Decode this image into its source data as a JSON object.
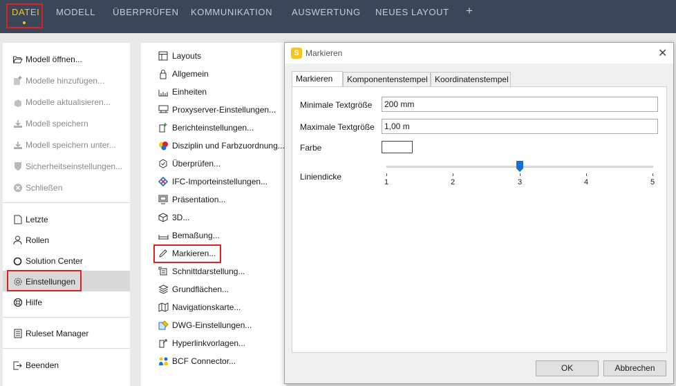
{
  "topbar": {
    "tabs": [
      "DATEI",
      "MODELL",
      "ÜBERPRÜFEN",
      "KOMMUNIKATION",
      "AUSWERTUNG",
      "NEUES LAYOUT"
    ],
    "add_tab": "+",
    "active_tab": "DATEI"
  },
  "left_menu": {
    "items": [
      {
        "label": "Modell öffnen...",
        "icon": "folder-open-icon",
        "enabled": true
      },
      {
        "label": "Modelle hinzufügen...",
        "icon": "add-model-icon",
        "enabled": false
      },
      {
        "label": "Modelle aktualisieren...",
        "icon": "refresh-model-icon",
        "enabled": false
      },
      {
        "label": "Modell speichern",
        "icon": "save-icon",
        "enabled": false
      },
      {
        "label": "Modell speichern unter...",
        "icon": "save-as-icon",
        "enabled": false
      },
      {
        "label": "Sicherheitseinstellungen...",
        "icon": "shield-icon",
        "enabled": false
      },
      {
        "label": "Schließen",
        "icon": "close-circle-icon",
        "enabled": false
      },
      {
        "label": "Letzte",
        "icon": "document-icon",
        "enabled": true
      },
      {
        "label": "Rollen",
        "icon": "user-icon",
        "enabled": true
      },
      {
        "label": "Solution Center",
        "icon": "circle-icon",
        "enabled": true
      },
      {
        "label": "Einstellungen",
        "icon": "gear-icon",
        "enabled": true,
        "selected": true
      },
      {
        "label": "Hilfe",
        "icon": "lifebuoy-icon",
        "enabled": true
      },
      {
        "label": "Ruleset Manager",
        "icon": "ruleset-icon",
        "enabled": true
      },
      {
        "label": "Beenden",
        "icon": "exit-icon",
        "enabled": true
      }
    ]
  },
  "settings_menu": {
    "items": [
      {
        "label": "Layouts",
        "icon": "layout-icon"
      },
      {
        "label": "Allgemein",
        "icon": "lock-icon"
      },
      {
        "label": "Einheiten",
        "icon": "ruler-icon"
      },
      {
        "label": "Proxyserver-Einstellungen...",
        "icon": "proxy-icon"
      },
      {
        "label": "Berichteinstellungen...",
        "icon": "report-icon"
      },
      {
        "label": "Disziplin und Farbzuordnung...",
        "icon": "color-discipline-icon"
      },
      {
        "label": "Überprüfen...",
        "icon": "check-icon"
      },
      {
        "label": "IFC-Importeinstellungen...",
        "icon": "ifc-icon"
      },
      {
        "label": "Präsentation...",
        "icon": "presentation-icon"
      },
      {
        "label": "3D...",
        "icon": "cube-icon"
      },
      {
        "label": "Bemaßung...",
        "icon": "dimension-icon"
      },
      {
        "label": "Markieren...",
        "icon": "pencil-icon",
        "selected": true
      },
      {
        "label": "Schnittdarstellung...",
        "icon": "section-icon"
      },
      {
        "label": "Grundflächen...",
        "icon": "layers-icon"
      },
      {
        "label": "Navigationskarte...",
        "icon": "map-icon"
      },
      {
        "label": "DWG-Einstellungen...",
        "icon": "dwg-icon"
      },
      {
        "label": "Hyperlinkvorlagen...",
        "icon": "hyperlink-icon"
      },
      {
        "label": "BCF Connector...",
        "icon": "bcf-icon"
      }
    ]
  },
  "dialog": {
    "title": "Markieren",
    "logo_letter": "S",
    "close": "✕",
    "tabs": [
      "Markieren",
      "Komponentenstempel",
      "Koordinatenstempel"
    ],
    "active_tab": "Markieren",
    "fields": {
      "min_text_label": "Minimale Textgröße",
      "min_text_value": "200 mm",
      "max_text_label": "Maximale Textgröße",
      "max_text_value": "1,00 m",
      "color_label": "Farbe",
      "color_value": "#ffffff",
      "line_label": "Liniendicke",
      "line_value": 3,
      "line_min": 1,
      "line_max": 5,
      "line_ticks": [
        "1",
        "2",
        "3",
        "4",
        "5"
      ]
    },
    "ok_label": "OK",
    "cancel_label": "Abbrechen"
  },
  "colors": {
    "topbar_bg": "#3a4758",
    "accent_yellow": "#f5c518",
    "highlight_red": "#e02020",
    "slider_thumb": "#1a6fd1"
  }
}
